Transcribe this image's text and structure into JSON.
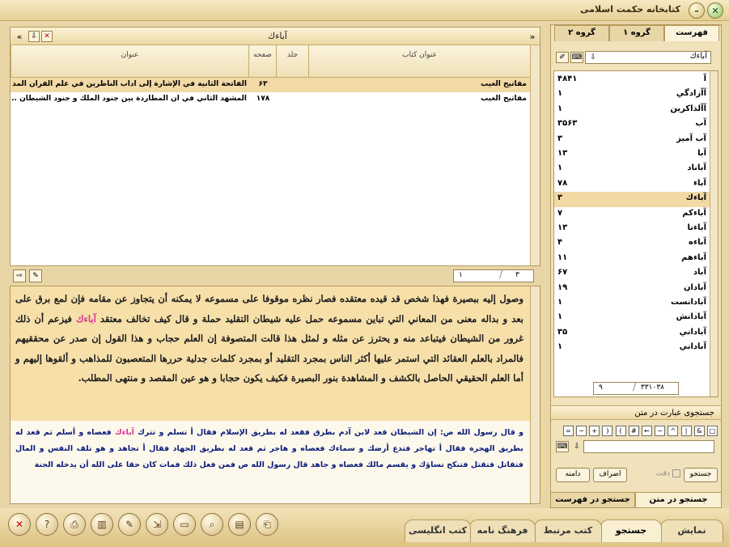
{
  "window": {
    "title": "کتابخانه حکمت اسلامی",
    "minimize_label": "–",
    "close_label": "✕"
  },
  "right_tabs": [
    "فهرست",
    "گروه ۱",
    "گروه ۲"
  ],
  "index_search": {
    "value": "آباءك"
  },
  "index_list": [
    {
      "word": "آ",
      "count": "۴۸۴۱"
    },
    {
      "word": "آآزادگي",
      "count": "۱"
    },
    {
      "word": "آآلذاكرين",
      "count": "۱"
    },
    {
      "word": "آب",
      "count": "۳۵۶۳"
    },
    {
      "word": "آب آميز",
      "count": "۳"
    },
    {
      "word": "آبا",
      "count": "۱۳"
    },
    {
      "word": "آباناد",
      "count": "۱"
    },
    {
      "word": "آباء",
      "count": "۷۸"
    },
    {
      "word": "آباءك",
      "count": "۳"
    },
    {
      "word": "آباءكم",
      "count": "۷"
    },
    {
      "word": "آباءنا",
      "count": "۱۳"
    },
    {
      "word": "آباءه",
      "count": "۴"
    },
    {
      "word": "آباءهم",
      "count": "۱۱"
    },
    {
      "word": "آباد",
      "count": "۶۷"
    },
    {
      "word": "آبادان",
      "count": "۱۹"
    },
    {
      "word": "آبادانست",
      "count": "۱"
    },
    {
      "word": "آبادانش",
      "count": "۱"
    },
    {
      "word": "آباداني",
      "count": "۳۵"
    },
    {
      "word": "آباداني",
      "count": "۱"
    }
  ],
  "index_count": {
    "left": "۹",
    "right": "۳۳۱۰۳۸"
  },
  "text_search": {
    "title": "جستجوی عبارت در متن",
    "operators": [
      "□",
      "&",
      "|",
      "^",
      "~",
      "←",
      "#",
      "(",
      ")",
      "+",
      "−",
      "="
    ],
    "checkbox_label": "دقت",
    "btn_search": "جستجو",
    "btn_add": "اضراف",
    "btn_range": "دامنه"
  },
  "right_bottom_tabs": [
    "جستجو در متن",
    "جستجو در فهرست"
  ],
  "list_panel": {
    "title": "آباءك",
    "columns": {
      "book": "عنوان کتاب",
      "vol": "جلد",
      "page": "صفحه",
      "title": "عنوان"
    },
    "rows": [
      {
        "book": "مفاتيح الغيب",
        "vol": "",
        "page": "۶۳",
        "title": "الفاتحة الثانية في الإشارة إلى آداب الناظرين في علم القرآن المد ..."
      },
      {
        "book": "مفاتيح الغيب",
        "vol": "",
        "page": "۱۷۸",
        "title": "المشهد الثاني في أن المطاردة بين جنود الملك و جنود الشيطان ..."
      }
    ]
  },
  "pager": {
    "current": "۱",
    "total": "۳"
  },
  "text": {
    "para1_before": "وصول إليه ببصيرة فهذا شخص قد قيده معتقده فصار نظره موقوفا على مسموعه لا يمكنه أن يتجاوز عن مقامه فإن لمع برق على بعد و بداله معنى من المعاني التي تباين مسموعه حمل عليه شيطان التقليد حملة و قال كيف تخالف معتقد ",
    "para1_hl": "آباءك",
    "para1_after": " فيزعم أن ذلك غرور من الشيطان فيتباعد منه و يحترز عن مثله و لمثل هذا قالت المتصوفة إن العلم حجاب و هذا القول إن صدر عن محققيهم فالمراد بالعلم العقائد التي استمر عليها أكثر الناس بمجرد التقليد أو بمجرد كلمات جدلية حررها المتعصبون للمذاهب و ألقوها إليهم و أما العلم الحقيقي الحاصل بالكشف و المشاهدة بنور البصيرة فكيف يكون حجابا و هو عين المقصد و منتهى المطلب.",
    "para2_before": "و قال رسول الله ص: إن الشيطان قعد لابن آدم بطرق فقعد له بطريق الإسلام فقال أ تسلم و تترك ",
    "para2_hl": "آباءك",
    "para2_after": " فعصاه و أسلم ثم قعد له بطريق الهجرة فقال أ تهاجر فتدع أرضك و سماءك فعصاه و هاجر ثم قعد له بطريق الجهاد فقال أ تجاهد و هو تلف النفس و المال فتقاتل فتقتل فتنكح نساؤك و يقسم مالك فعصاه و جاهد قال رسول الله ص فمن فعل ذلك فمات كان حقا على الله أن يدخله الجنة"
  },
  "bottom_tabs": [
    "نمایش",
    "جستجو",
    "کتب مرتبط",
    "فرهنگ نامه",
    "کتب انگلیسی"
  ],
  "bottom_icons": [
    "close-icon",
    "help-icon",
    "print-icon",
    "books-icon",
    "edit-icon",
    "export-icon",
    "page-icon",
    "search-icon",
    "library-icon",
    "stamp-icon"
  ]
}
